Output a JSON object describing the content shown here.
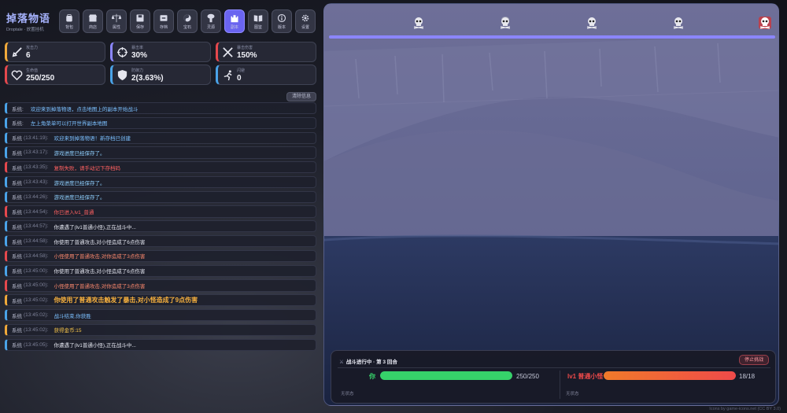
{
  "brand": {
    "title": "掉落物语",
    "subtitle": "Droptale · 放置挂机"
  },
  "nav": [
    {
      "label": "背包",
      "icon": "backpack-icon"
    },
    {
      "label": "商店",
      "icon": "shop-icon"
    },
    {
      "label": "属性",
      "icon": "attributes-icon"
    },
    {
      "label": "保存",
      "icon": "save-icon"
    },
    {
      "label": "存档",
      "icon": "archive-icon"
    },
    {
      "label": "宝石",
      "icon": "yin-yang-icon"
    },
    {
      "label": "灵源",
      "icon": "mushroom-cloud-icon"
    },
    {
      "label": "副本",
      "icon": "dungeon-castle-icon",
      "active": true
    },
    {
      "label": "图鉴",
      "icon": "book-icon"
    },
    {
      "label": "版本",
      "icon": "info-icon"
    },
    {
      "label": "设置",
      "icon": "gear-icon"
    }
  ],
  "stats": [
    {
      "label": "攻击力",
      "value": "6",
      "icon": "sword-icon",
      "color": "#f0a93a"
    },
    {
      "label": "暴击率",
      "value": "30%",
      "icon": "crosshair-icon",
      "color": "#8b86ff"
    },
    {
      "label": "暴击伤害",
      "value": "150%",
      "icon": "crossed-swords-icon",
      "color": "#e5484d"
    },
    {
      "label": "生命值",
      "value": "250/250",
      "icon": "heart-icon",
      "color": "#e5484d"
    },
    {
      "label": "防御力",
      "value": "2(3.63%)",
      "icon": "shield-icon",
      "color": "#4aa3e8"
    },
    {
      "label": "闪避",
      "value": "0",
      "icon": "running-icon",
      "color": "#4aa3e8"
    }
  ],
  "clear_label": "清除信息",
  "log": [
    {
      "source": "系统:",
      "time": "",
      "message": "欢迎来到掉落物语，点击地图上的副本开始战斗",
      "tone": "c-blue"
    },
    {
      "source": "系统:",
      "time": "",
      "message": "左上角菜单可以打开世界副本地图",
      "tone": "c-blue"
    },
    {
      "source": "系统",
      "time": "(13:41:19):",
      "message": "欢迎来到掉落物语！新存档已创建",
      "tone": "c-blue"
    },
    {
      "source": "系统",
      "time": "(13:43:17):",
      "message": "游戏进度已经保存了。",
      "tone": "c-teal"
    },
    {
      "source": "系统",
      "time": "(13:43:35):",
      "message": "复制失败，请手动记下存档码",
      "tone": "c-red"
    },
    {
      "source": "系统",
      "time": "(13:43:43):",
      "message": "游戏进度已经保存了。",
      "tone": "c-teal"
    },
    {
      "source": "系统",
      "time": "(13:44:26):",
      "message": "游戏进度已经保存了。",
      "tone": "c-teal"
    },
    {
      "source": "系统",
      "time": "(13:44:54):",
      "message": "你已进入lv1_普通",
      "tone": "c-red"
    },
    {
      "source": "系统",
      "time": "(13:44:57):",
      "message": "你遭遇了(lv1普通小怪),正在战斗中...",
      "tone": "c-white"
    },
    {
      "source": "系统",
      "time": "(13:44:58):",
      "message": "你使用了普通攻击,对小怪造成了6点伤害",
      "tone": "c-white"
    },
    {
      "source": "系统",
      "time": "(13:44:58):",
      "message": "小怪使用了普通攻击,对你造成了3点伤害",
      "tone": "c-orange"
    },
    {
      "source": "系统",
      "time": "(13:45:00):",
      "message": "你使用了普通攻击,对小怪造成了6点伤害",
      "tone": "c-white"
    },
    {
      "source": "系统",
      "time": "(13:45:00):",
      "message": "小怪使用了普通攻击,对你造成了3点伤害",
      "tone": "c-orange"
    },
    {
      "source": "系统",
      "time": "(13:45:02):",
      "message": "你使用了普通攻击触发了暴击,对小怪造成了9点伤害",
      "tone": "c-gold"
    },
    {
      "source": "系统",
      "time": "(13:45:02):",
      "message": "战斗结束,你获胜",
      "tone": "c-blue"
    },
    {
      "source": "系统",
      "time": "(13:45:02):",
      "message": "获得金币:15",
      "tone": "c-coin"
    },
    {
      "source": "系统",
      "time": "(13:45:05):",
      "message": "你遭遇了(lv1普通小怪),正在战斗中...",
      "tone": "c-white"
    }
  ],
  "progress": {
    "markers": [
      {
        "icon": "skull-icon",
        "color": "#e8e8ee"
      },
      {
        "icon": "helmeted-skull-icon",
        "color": "#e8e8ee"
      },
      {
        "icon": "skull-icon",
        "color": "#e8e8ee"
      },
      {
        "icon": "skull-icon",
        "color": "#e8e8ee"
      },
      {
        "icon": "boss-skull-icon",
        "color": "#e5484d"
      }
    ]
  },
  "battle": {
    "header_icon": "⚔",
    "header": "战斗进行中 · 第 3 回合",
    "flee_label": "停止挑战",
    "player": {
      "name": "你",
      "hp": 250,
      "hp_max": 250,
      "hp_text": "250/250",
      "status": "无状态",
      "color": "#36d26a"
    },
    "enemy": {
      "name": "lv1 普通小怪",
      "hp": 18,
      "hp_max": 18,
      "hp_text": "18/18",
      "status": "无状态",
      "color": "#ef4a4a"
    }
  },
  "credit": "Icons by game-icons.net (CC BY 3.0)"
}
